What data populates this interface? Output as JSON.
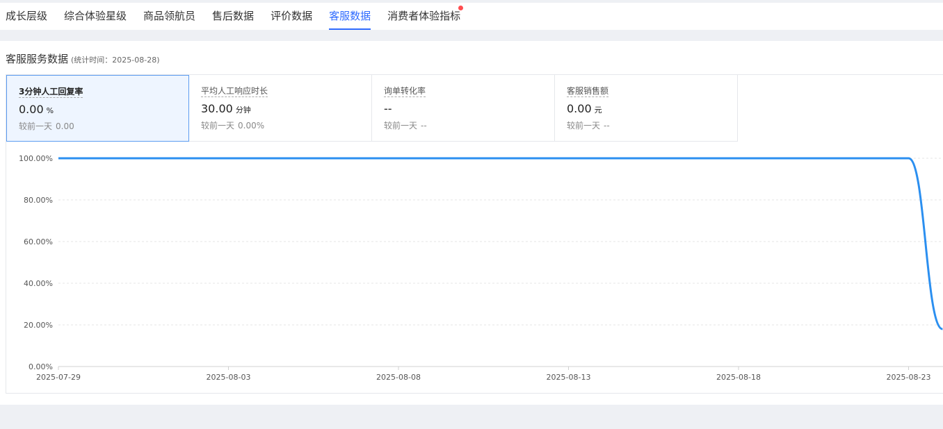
{
  "tabs": [
    {
      "label": "成长层级",
      "active": false,
      "dot": false
    },
    {
      "label": "综合体验星级",
      "active": false,
      "dot": false
    },
    {
      "label": "商品领航员",
      "active": false,
      "dot": false
    },
    {
      "label": "售后数据",
      "active": false,
      "dot": false
    },
    {
      "label": "评价数据",
      "active": false,
      "dot": false
    },
    {
      "label": "客服数据",
      "active": true,
      "dot": false
    },
    {
      "label": "消费者体验指标",
      "active": false,
      "dot": true
    }
  ],
  "section": {
    "title": "客服服务数据",
    "subtitle": "(统计时间：2025-08-28)"
  },
  "cards": [
    {
      "title": "3分钟人工回复率",
      "value": "0.00",
      "unit": "%",
      "compare_label": "较前一天",
      "compare_value": "0.00",
      "active": true
    },
    {
      "title": "平均人工响应时长",
      "value": "30.00",
      "unit": "分钟",
      "compare_label": "较前一天",
      "compare_value": "0.00%",
      "active": false
    },
    {
      "title": "询单转化率",
      "value": "--",
      "unit": "",
      "compare_label": "较前一天",
      "compare_value": "--",
      "active": false
    },
    {
      "title": "客服销售额",
      "value": "0.00",
      "unit": "元",
      "compare_label": "较前一天",
      "compare_value": "--",
      "active": false
    }
  ],
  "colors": {
    "accent": "#2f6bff",
    "line": "#2b8ff0",
    "dot": "#ff4d4f"
  },
  "chart_data": {
    "type": "line",
    "x": [
      "2025-07-29",
      "2025-07-30",
      "2025-07-31",
      "2025-08-01",
      "2025-08-02",
      "2025-08-03",
      "2025-08-04",
      "2025-08-05",
      "2025-08-06",
      "2025-08-07",
      "2025-08-08",
      "2025-08-09",
      "2025-08-10",
      "2025-08-11",
      "2025-08-12",
      "2025-08-13",
      "2025-08-14",
      "2025-08-15",
      "2025-08-16",
      "2025-08-17",
      "2025-08-18",
      "2025-08-19",
      "2025-08-20",
      "2025-08-21",
      "2025-08-22",
      "2025-08-23",
      "2025-08-24"
    ],
    "series": [
      {
        "values": [
          100,
          100,
          100,
          100,
          100,
          100,
          100,
          100,
          100,
          100,
          100,
          100,
          100,
          100,
          100,
          100,
          100,
          100,
          100,
          100,
          100,
          100,
          100,
          100,
          100,
          100,
          18
        ]
      }
    ],
    "y_tick_labels": [
      "0.00%",
      "20.00%",
      "40.00%",
      "60.00%",
      "80.00%",
      "100.00%"
    ],
    "x_tick_labels": [
      "2025-07-29",
      "2025-08-03",
      "2025-08-08",
      "2025-08-13",
      "2025-08-18",
      "2025-08-23"
    ],
    "ylim": [
      0,
      100
    ],
    "grid": true
  }
}
